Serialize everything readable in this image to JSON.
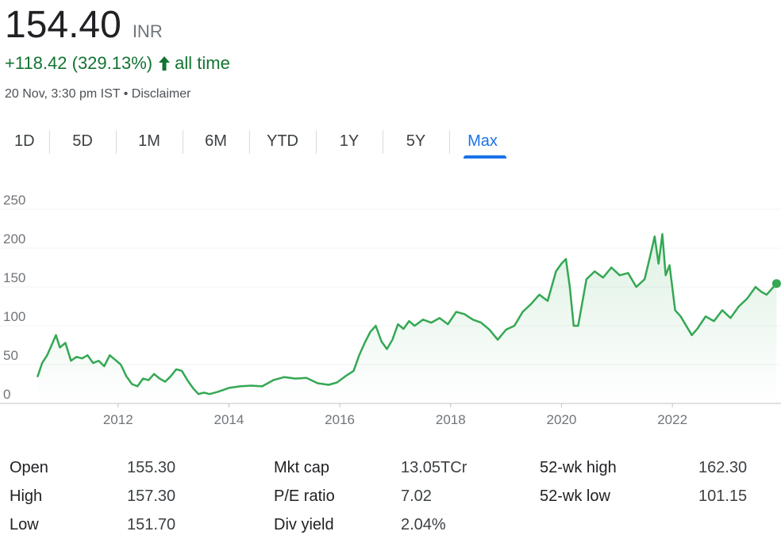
{
  "price": {
    "value": "154.40",
    "currency": "INR"
  },
  "change": {
    "text": "+118.42 (329.13%)",
    "period": "all time",
    "color": "#137333"
  },
  "meta": {
    "timestamp": "20 Nov, 3:30 pm IST",
    "separator": "•",
    "disclaimer": "Disclaimer"
  },
  "tabs": [
    {
      "label": "1D",
      "active": false
    },
    {
      "label": "5D",
      "active": false
    },
    {
      "label": "1M",
      "active": false
    },
    {
      "label": "6M",
      "active": false
    },
    {
      "label": "YTD",
      "active": false
    },
    {
      "label": "1Y",
      "active": false
    },
    {
      "label": "5Y",
      "active": false
    },
    {
      "label": "Max",
      "active": true
    }
  ],
  "colors": {
    "line": "#34a853",
    "accent": "#1a73e8",
    "grid": "#f1f3f4"
  },
  "chart_data": {
    "type": "line",
    "x_type": "year",
    "xlim": [
      2010.5,
      2023.96
    ],
    "ylim": [
      0,
      250
    ],
    "yticks": [
      0,
      50,
      100,
      150,
      200,
      250
    ],
    "xticks": [
      2012,
      2014,
      2016,
      2018,
      2020,
      2022
    ],
    "grid": true,
    "series": [
      {
        "x": [
          2010.55,
          2010.63,
          2010.72,
          2010.8,
          2010.88,
          2010.95,
          2011.05,
          2011.15,
          2011.25,
          2011.35,
          2011.45,
          2011.55,
          2011.65,
          2011.75,
          2011.85,
          2011.95,
          2012.05,
          2012.15,
          2012.25,
          2012.35,
          2012.45,
          2012.55,
          2012.65,
          2012.75,
          2012.85,
          2012.95,
          2013.05,
          2013.15,
          2013.25,
          2013.35,
          2013.45,
          2013.55,
          2013.65,
          2013.8,
          2014.0,
          2014.2,
          2014.4,
          2014.6,
          2014.8,
          2015.0,
          2015.2,
          2015.4,
          2015.6,
          2015.8,
          2015.95,
          2016.1,
          2016.25,
          2016.35,
          2016.45,
          2016.55,
          2016.65,
          2016.75,
          2016.85,
          2016.95,
          2017.05,
          2017.15,
          2017.25,
          2017.35,
          2017.5,
          2017.65,
          2017.8,
          2017.95,
          2018.1,
          2018.25,
          2018.4,
          2018.55,
          2018.7,
          2018.85,
          2019.0,
          2019.15,
          2019.3,
          2019.45,
          2019.6,
          2019.75,
          2019.9,
          2020.0,
          2020.08,
          2020.15,
          2020.22,
          2020.3,
          2020.45,
          2020.6,
          2020.75,
          2020.9,
          2021.05,
          2021.2,
          2021.35,
          2021.5,
          2021.6,
          2021.68,
          2021.75,
          2021.82,
          2021.88,
          2021.95,
          2022.05,
          2022.15,
          2022.25,
          2022.35,
          2022.45,
          2022.6,
          2022.75,
          2022.9,
          2023.05,
          2023.2,
          2023.35,
          2023.5,
          2023.6,
          2023.7,
          2023.8,
          2023.88
        ],
        "y": [
          35,
          52,
          62,
          75,
          88,
          72,
          78,
          55,
          60,
          58,
          62,
          52,
          55,
          48,
          62,
          56,
          50,
          35,
          25,
          22,
          32,
          30,
          38,
          32,
          28,
          35,
          44,
          42,
          30,
          20,
          12,
          14,
          12,
          15,
          20,
          22,
          23,
          22,
          30,
          34,
          32,
          33,
          26,
          24,
          27,
          35,
          42,
          62,
          78,
          92,
          100,
          80,
          70,
          82,
          102,
          96,
          106,
          100,
          108,
          104,
          110,
          102,
          118,
          115,
          108,
          104,
          95,
          82,
          95,
          100,
          118,
          128,
          140,
          132,
          170,
          180,
          186,
          150,
          100,
          100,
          160,
          170,
          162,
          175,
          165,
          168,
          150,
          160,
          190,
          215,
          180,
          218,
          165,
          178,
          120,
          112,
          100,
          88,
          96,
          112,
          106,
          120,
          110,
          125,
          135,
          150,
          144,
          140,
          148,
          154.4
        ]
      }
    ]
  },
  "stats": [
    [
      {
        "label": "Open",
        "value": "155.30"
      },
      {
        "label": "High",
        "value": "157.30"
      },
      {
        "label": "Low",
        "value": "151.70"
      }
    ],
    [
      {
        "label": "Mkt cap",
        "value": "13.05TCr"
      },
      {
        "label": "P/E ratio",
        "value": "7.02"
      },
      {
        "label": "Div yield",
        "value": "2.04%"
      }
    ],
    [
      {
        "label": "52-wk high",
        "value": "162.30"
      },
      {
        "label": "52-wk low",
        "value": "101.15"
      }
    ]
  ]
}
